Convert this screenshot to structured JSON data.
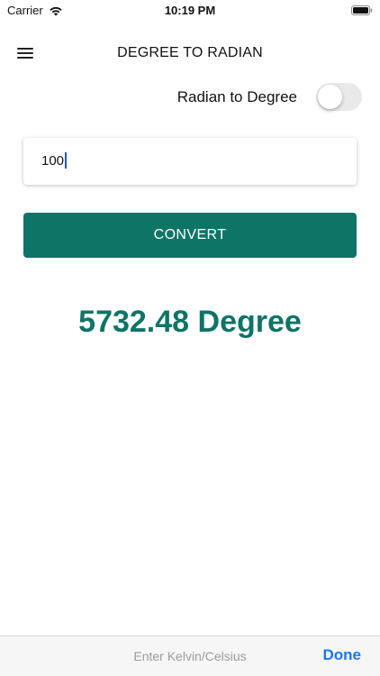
{
  "status_bar": {
    "carrier": "Carrier",
    "time": "10:19 PM"
  },
  "header": {
    "title": "DEGREE TO RADIAN"
  },
  "toggle": {
    "label": "Radian to Degree",
    "on": false
  },
  "input": {
    "value": "100"
  },
  "convert_button": {
    "label": "CONVERT"
  },
  "result": {
    "text": "5732.48 Degree"
  },
  "keyboard_toolbar": {
    "placeholder_hint": "Enter Kelvin/Celsius",
    "done_label": "Done"
  },
  "colors": {
    "accent": "#0e7466",
    "done_blue": "#1877f2",
    "caret_blue": "#1a57d6"
  }
}
